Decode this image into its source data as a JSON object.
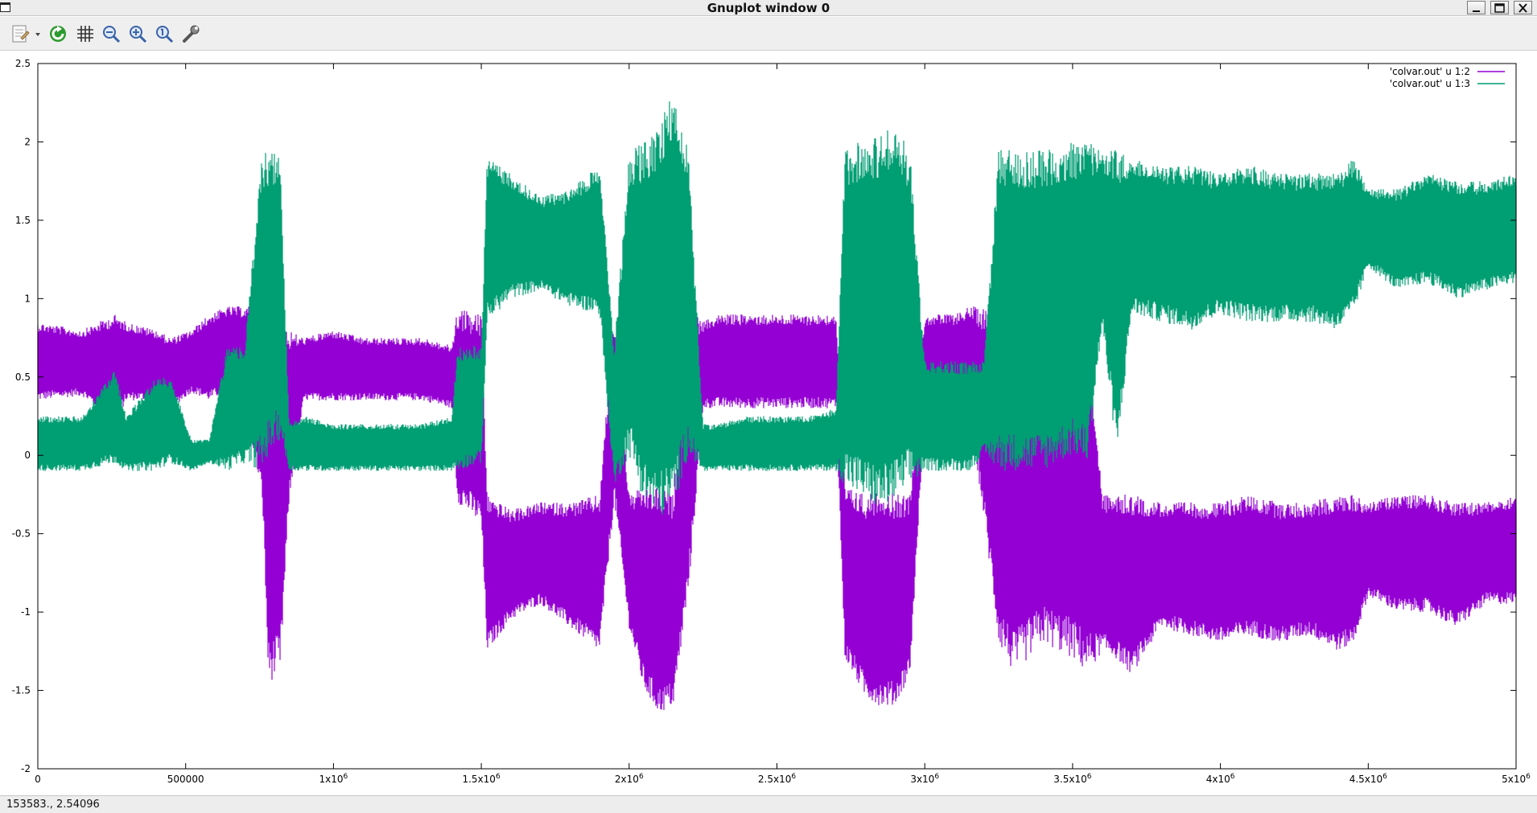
{
  "window": {
    "title": "Gnuplot window 0"
  },
  "toolbar": {
    "items": [
      "copy-print-icon",
      "replot-icon",
      "grid-icon",
      "zoom-out-icon",
      "zoom-in-icon",
      "zoom-autoscale-icon",
      "options-wrench-icon"
    ]
  },
  "status": {
    "coordinates": "153583.,  2.54096"
  },
  "chart_data": {
    "type": "line",
    "xlim": [
      0,
      5000000
    ],
    "ylim": [
      -2,
      2.5
    ],
    "x_ticks": [
      0,
      500000,
      1000000,
      1500000,
      2000000,
      2500000,
      3000000,
      3500000,
      4000000,
      4500000,
      5000000
    ],
    "x_tick_labels": [
      {
        "base": "0",
        "exp": ""
      },
      {
        "base": "500000",
        "exp": ""
      },
      {
        "base": "1x10",
        "exp": "6"
      },
      {
        "base": "1.5x10",
        "exp": "6"
      },
      {
        "base": "2x10",
        "exp": "6"
      },
      {
        "base": "2.5x10",
        "exp": "6"
      },
      {
        "base": "3x10",
        "exp": "6"
      },
      {
        "base": "3.5x10",
        "exp": "6"
      },
      {
        "base": "4x10",
        "exp": "6"
      },
      {
        "base": "4.5x10",
        "exp": "6"
      },
      {
        "base": "5x10",
        "exp": "6"
      }
    ],
    "y_ticks": [
      -2,
      -1.5,
      -1,
      -0.5,
      0,
      0.5,
      1,
      1.5,
      2,
      2.5
    ],
    "y_tick_labels": [
      "-2",
      "-1.5",
      "-1",
      "-0.5",
      "0",
      "0.5",
      "1",
      "1.5",
      "2",
      "2.5"
    ],
    "grid": false,
    "legend_position": "top-right",
    "series": [
      {
        "name": "'colvar.out' u 1:2",
        "color": "#9400d3",
        "envelope": {
          "x": [
            0,
            150000,
            260000,
            300000,
            400000,
            450000,
            520000,
            580000,
            640000,
            700000,
            760000,
            780000,
            820000,
            850000,
            900000,
            1000000,
            1100000,
            1200000,
            1300000,
            1400000,
            1420000,
            1500000,
            1520000,
            1600000,
            1700000,
            1800000,
            1900000,
            1950000,
            2000000,
            2050000,
            2100000,
            2150000,
            2200000,
            2250000,
            2300000,
            2400000,
            2500000,
            2600000,
            2700000,
            2730000,
            2800000,
            2850000,
            2900000,
            2950000,
            3000000,
            3050000,
            3100000,
            3150000,
            3200000,
            3250000,
            3300000,
            3400000,
            3500000,
            3550000,
            3600000,
            3650000,
            3700000,
            3800000,
            3900000,
            4000000,
            4100000,
            4200000,
            4300000,
            4400000,
            4450000,
            4500000,
            4600000,
            4700000,
            4800000,
            4900000,
            5000000
          ],
          "low": [
            0.35,
            0.38,
            0.2,
            0.35,
            0.35,
            0.3,
            0.4,
            0.35,
            0.4,
            0.35,
            -0.3,
            -1.45,
            -1.4,
            -0.3,
            0.35,
            0.35,
            0.35,
            0.35,
            0.35,
            0.3,
            -0.3,
            -0.45,
            -1.25,
            -1.05,
            -0.95,
            -1.1,
            -1.25,
            -0.3,
            -1.1,
            -1.5,
            -1.65,
            -1.6,
            -0.9,
            0.3,
            0.3,
            0.3,
            0.3,
            0.3,
            0.3,
            -1.3,
            -1.55,
            -1.6,
            -1.6,
            -1.4,
            0.3,
            0.3,
            0.3,
            0.3,
            -0.4,
            -1.2,
            -1.4,
            -1.2,
            -1.3,
            -1.4,
            -1.25,
            -1.3,
            -1.4,
            -1.1,
            -1.15,
            -1.2,
            -1.15,
            -1.2,
            -1.15,
            -1.25,
            -1.2,
            -0.9,
            -1.0,
            -1.0,
            -1.1,
            -0.95,
            -0.95
          ],
          "high": [
            0.85,
            0.8,
            0.9,
            0.85,
            0.8,
            0.75,
            0.8,
            0.9,
            0.95,
            0.95,
            0.95,
            0.8,
            0.85,
            0.8,
            0.75,
            0.8,
            0.75,
            0.75,
            0.75,
            0.7,
            0.95,
            0.9,
            -0.25,
            -0.35,
            -0.3,
            -0.3,
            -0.25,
            0.9,
            -0.25,
            -0.2,
            -0.2,
            -0.25,
            0.95,
            0.85,
            0.9,
            0.9,
            0.9,
            0.9,
            0.9,
            -0.2,
            -0.25,
            -0.2,
            -0.25,
            -0.25,
            0.9,
            0.9,
            0.9,
            0.95,
            0.95,
            0.95,
            0.9,
            0.9,
            0.9,
            0.9,
            -0.25,
            -0.25,
            -0.25,
            -0.3,
            -0.3,
            -0.3,
            -0.25,
            -0.3,
            -0.3,
            -0.25,
            -0.25,
            -0.3,
            -0.25,
            -0.25,
            -0.3,
            -0.3,
            -0.25
          ]
        }
      },
      {
        "name": "'colvar.out' u 1:3",
        "color": "#009e73",
        "envelope": {
          "x": [
            0,
            150000,
            260000,
            300000,
            400000,
            450000,
            520000,
            580000,
            640000,
            700000,
            760000,
            780000,
            820000,
            850000,
            900000,
            1000000,
            1100000,
            1200000,
            1300000,
            1400000,
            1420000,
            1500000,
            1520000,
            1600000,
            1700000,
            1800000,
            1900000,
            1950000,
            2000000,
            2050000,
            2100000,
            2150000,
            2200000,
            2250000,
            2300000,
            2400000,
            2500000,
            2600000,
            2700000,
            2730000,
            2800000,
            2850000,
            2900000,
            2950000,
            3000000,
            3050000,
            3100000,
            3150000,
            3200000,
            3250000,
            3300000,
            3400000,
            3500000,
            3550000,
            3600000,
            3650000,
            3700000,
            3800000,
            3900000,
            4000000,
            4100000,
            4200000,
            4300000,
            4400000,
            4450000,
            4500000,
            4600000,
            4700000,
            4800000,
            4900000,
            5000000
          ],
          "low": [
            -0.1,
            -0.1,
            -0.05,
            -0.1,
            -0.1,
            -0.05,
            -0.1,
            -0.05,
            -0.1,
            -0.05,
            -0.1,
            0.0,
            0.1,
            -0.1,
            -0.1,
            -0.1,
            -0.1,
            -0.1,
            -0.1,
            -0.1,
            -0.1,
            -0.05,
            0.85,
            1.0,
            1.05,
            0.95,
            0.9,
            -0.2,
            0.0,
            -0.3,
            -0.4,
            -0.35,
            0.0,
            -0.1,
            -0.1,
            -0.1,
            -0.1,
            -0.1,
            -0.1,
            -0.2,
            -0.3,
            -0.35,
            -0.3,
            -0.2,
            -0.1,
            -0.1,
            -0.1,
            -0.1,
            0.0,
            -0.1,
            -0.1,
            -0.1,
            0.0,
            -0.05,
            0.8,
            0.0,
            0.9,
            0.85,
            0.8,
            0.9,
            0.85,
            0.85,
            0.85,
            0.8,
            0.9,
            1.2,
            1.05,
            1.1,
            1.0,
            1.05,
            1.1
          ],
          "high": [
            0.25,
            0.25,
            0.55,
            0.25,
            0.5,
            0.5,
            0.1,
            0.1,
            0.7,
            0.7,
            1.95,
            1.95,
            1.9,
            0.2,
            0.25,
            0.2,
            0.2,
            0.2,
            0.2,
            0.25,
            0.7,
            0.7,
            1.9,
            1.8,
            1.65,
            1.7,
            1.85,
            0.7,
            1.95,
            2.0,
            2.1,
            2.35,
            1.95,
            0.2,
            0.2,
            0.25,
            0.25,
            0.25,
            0.3,
            1.95,
            2.05,
            2.05,
            2.1,
            1.95,
            0.6,
            0.6,
            0.6,
            0.6,
            0.6,
            1.95,
            1.95,
            1.95,
            2.0,
            2.0,
            1.95,
            1.95,
            1.9,
            1.85,
            1.85,
            1.8,
            1.85,
            1.8,
            1.8,
            1.8,
            1.9,
            1.7,
            1.7,
            1.8,
            1.75,
            1.75,
            1.8
          ]
        }
      }
    ]
  }
}
